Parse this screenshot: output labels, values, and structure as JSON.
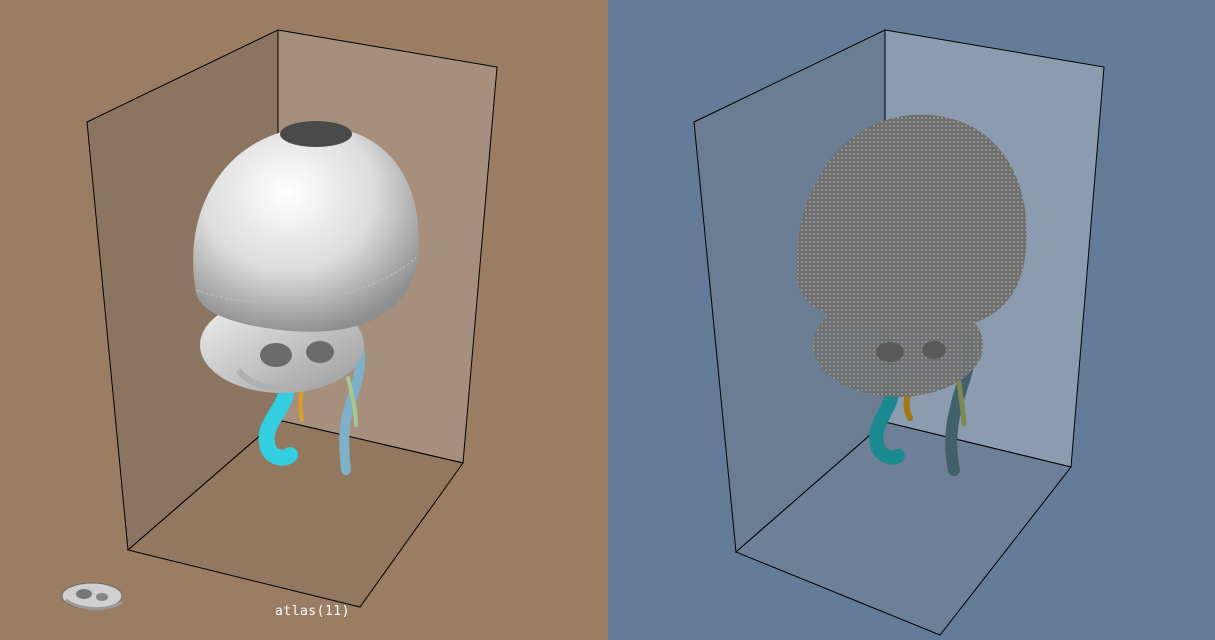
{
  "viewports": {
    "left": {
      "background": "#9a7d62",
      "render_mode": "surface",
      "caption": "atlas(11)"
    },
    "right": {
      "background": "#647c98",
      "render_mode": "point-cloud"
    }
  },
  "structures": [
    {
      "name": "skull",
      "color_surface": "#e8e8e8",
      "color_points": "#7a7a7a"
    },
    {
      "name": "left-vessel",
      "color_surface": "#33cfe0",
      "color_points": "#1a8a90"
    },
    {
      "name": "vertebral-artery",
      "color_surface": "#d8a020",
      "color_points": "#a07a10"
    },
    {
      "name": "right-vessel",
      "color_surface": "#7fb0c8",
      "color_points": "#40606c"
    },
    {
      "name": "small-branch",
      "color_surface": "#a8c890",
      "color_points": "#7a8a50"
    }
  ],
  "icons": {
    "thumbnail": "skull-thumbnail-icon"
  }
}
